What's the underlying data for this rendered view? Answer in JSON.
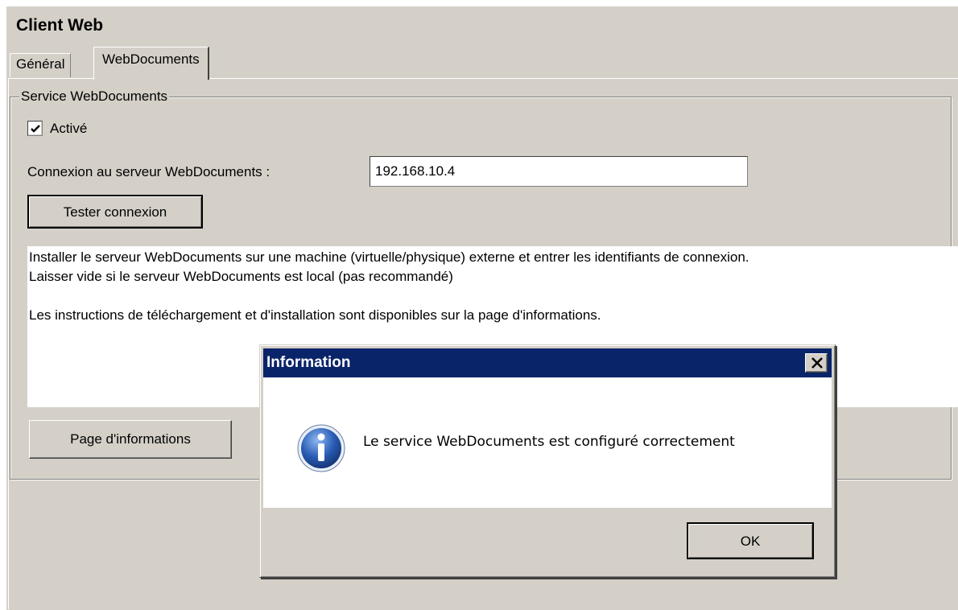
{
  "window": {
    "title": "Client Web"
  },
  "tabs": [
    {
      "label": "Général"
    },
    {
      "label": "WebDocuments"
    }
  ],
  "group": {
    "legend": "Service WebDocuments",
    "enabled_label": "Activé",
    "enabled_checked": true,
    "server_label": "Connexion au serveur WebDocuments :",
    "server_value": "192.168.10.4",
    "test_button": "Tester connexion",
    "info_line1": "Installer le serveur WebDocuments sur une machine (virtuelle/physique) externe et entrer les identifiants de connexion.",
    "info_line2": "Laisser vide si le serveur WebDocuments est local (pas recommandé)",
    "info_line3": "Les instructions de téléchargement et d'installation sont disponibles sur la page d'informations.",
    "info_page_button": "Page d'informations"
  },
  "dialog": {
    "title": "Information",
    "message": "Le service WebDocuments est configuré correctement",
    "ok_button": "OK",
    "icon": "info-icon"
  },
  "colors": {
    "window_bg": "#d4d0c8",
    "titlebar": "#0a246a",
    "info_icon": "#2a5db5"
  }
}
